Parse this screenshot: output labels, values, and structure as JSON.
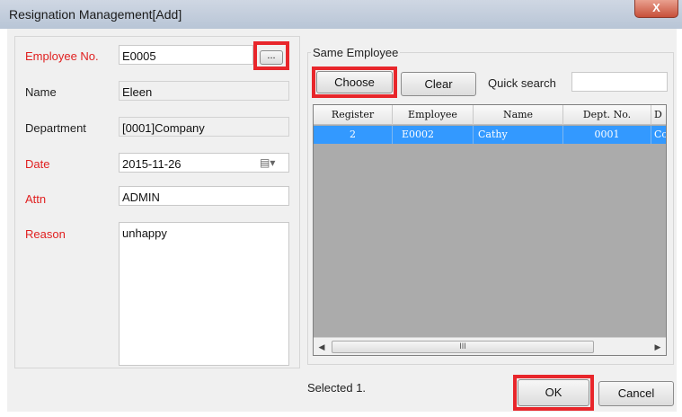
{
  "window": {
    "title": "Resignation Management[Add]",
    "close_glyph": "X"
  },
  "form": {
    "employee_no": {
      "label": "Employee No.",
      "value": "E0005",
      "browse_label": "..."
    },
    "name": {
      "label": "Name",
      "value": "Eleen"
    },
    "department": {
      "label": "Department",
      "value": "[0001]Company"
    },
    "date": {
      "label": "Date",
      "value": "2015-11-26",
      "picker_glyph": "▤▾"
    },
    "attn": {
      "label": "Attn",
      "value": "ADMIN"
    },
    "reason": {
      "label": "Reason",
      "value": "unhappy"
    }
  },
  "same_employee": {
    "title": "Same Employee",
    "choose_label": "Choose",
    "clear_label": "Clear",
    "quick_search_label": "Quick search",
    "quick_search_value": "",
    "columns": [
      "Register",
      "Employee",
      "Name",
      "Dept. No.",
      "D"
    ],
    "rows": [
      [
        "2",
        "E0002",
        "Cathy",
        "0001",
        "Co"
      ]
    ],
    "scroll": {
      "left_glyph": "◀",
      "right_glyph": "▶",
      "thumb_grip": "III"
    }
  },
  "status": {
    "selected_text": "Selected 1."
  },
  "buttons": {
    "ok_label": "OK",
    "cancel_label": "Cancel"
  },
  "colors": {
    "required_label": "#e02020",
    "highlight_box": "#e8262b",
    "selected_row": "#3399ff"
  }
}
